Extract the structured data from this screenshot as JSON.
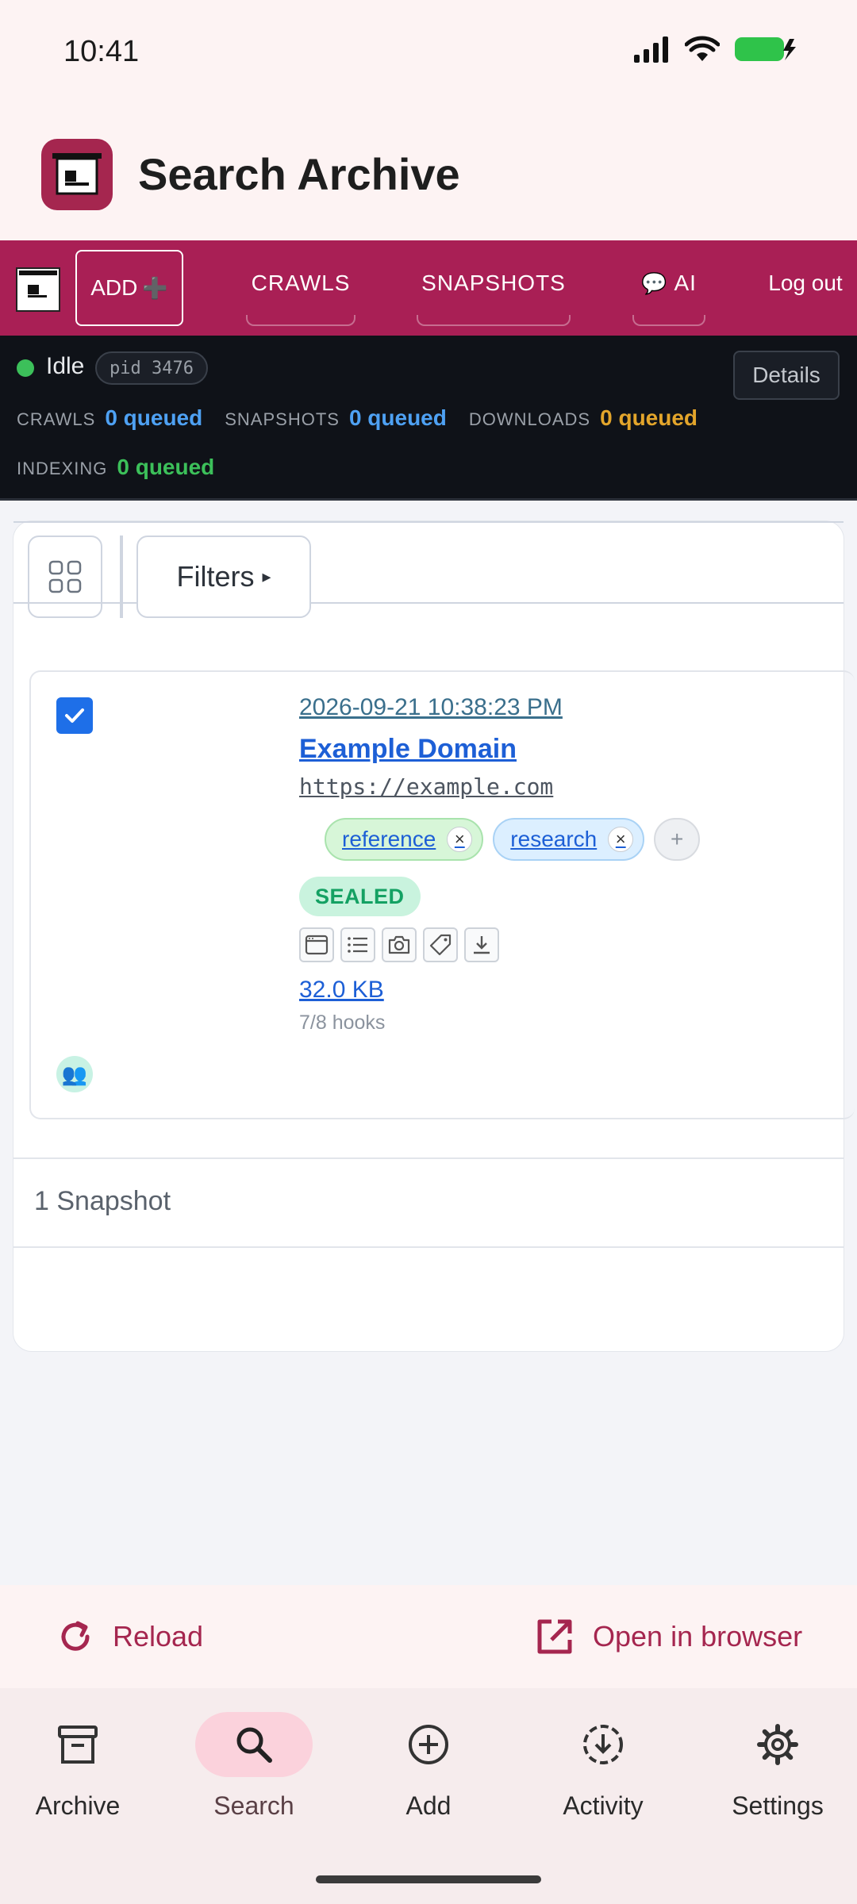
{
  "status_bar": {
    "time": "10:41"
  },
  "app": {
    "title": "Search Archive"
  },
  "web_nav": {
    "add_label": "ADD",
    "add_glyph": "➕",
    "links": [
      "CRAWLS",
      "SNAPSHOTS",
      "AI",
      "Log out"
    ],
    "ai_glyph": "💬"
  },
  "queue": {
    "state": "Idle",
    "pid": "pid 3476",
    "details_label": "Details",
    "items": [
      {
        "label": "CRAWLS",
        "value": "0 queued",
        "color": "#4ea1f3"
      },
      {
        "label": "SNAPSHOTS",
        "value": "0 queued",
        "color": "#4ea1f3"
      },
      {
        "label": "DOWNLOADS",
        "value": "0 queued",
        "color": "#e3a52b"
      },
      {
        "label": "INDEXING",
        "value": "0 queued",
        "color": "#3cc05a"
      }
    ]
  },
  "toolbar": {
    "filters_label": "Filters",
    "filters_glyph": "▸"
  },
  "snapshot": {
    "timestamp": "2026-09-21 10:38:23 PM",
    "title": "Example Domain",
    "url": "https://example.com",
    "tags": [
      "reference",
      "research"
    ],
    "tag_remove_glyph": "×",
    "tag_add_glyph": "+",
    "status": "SEALED",
    "size": "32.0 KB",
    "hooks": "7/8 hooks",
    "user_glyph": "👥"
  },
  "summary": {
    "count": "1 Snapshot"
  },
  "action_bar": {
    "reload_label": "Reload",
    "open_label": "Open in browser"
  },
  "bottom_nav": {
    "items": [
      "Archive",
      "Search",
      "Add",
      "Activity",
      "Settings"
    ],
    "active": "Search"
  },
  "colors": {
    "brand": "#a91f55",
    "accent": "#a5264f",
    "link": "#1d5fd6"
  }
}
